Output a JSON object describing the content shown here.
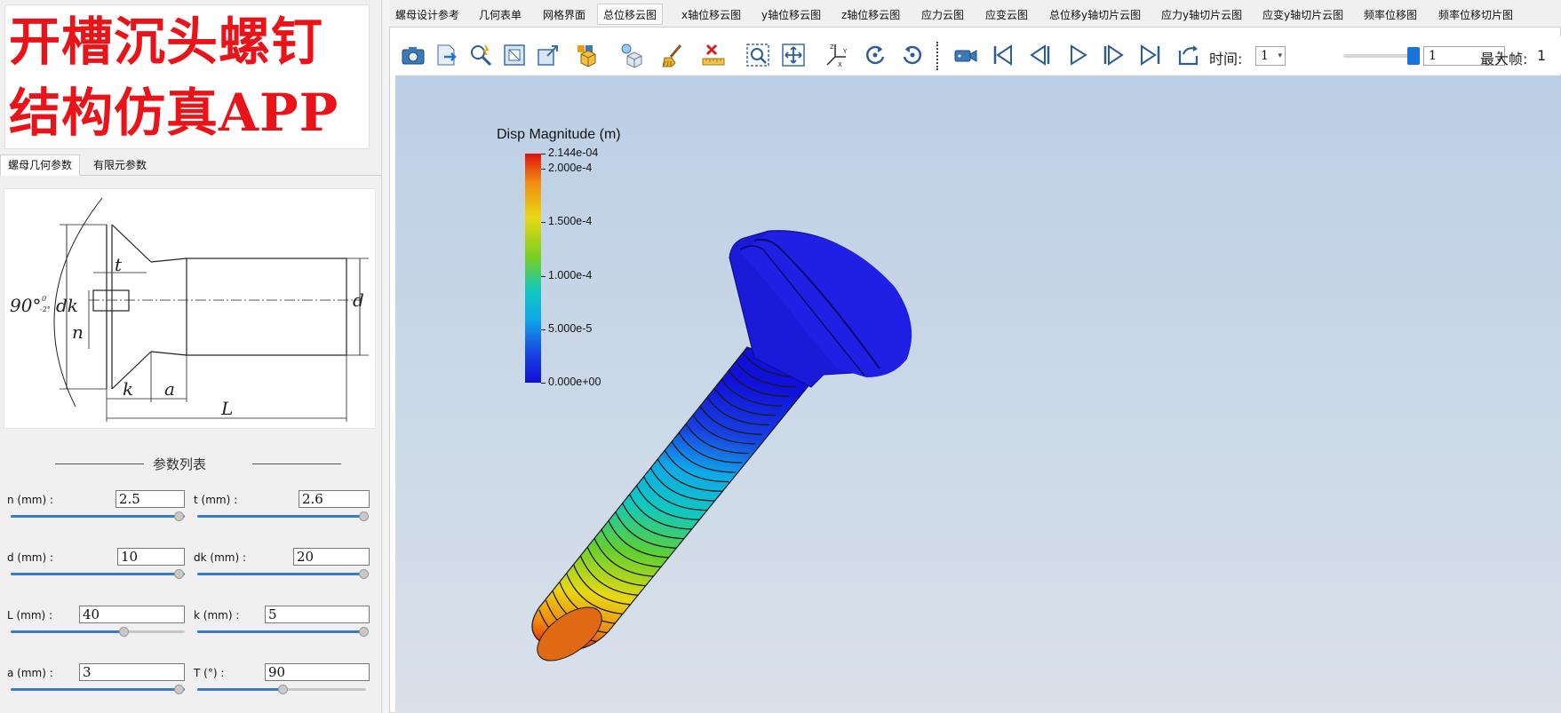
{
  "banner": {
    "line1": "开槽沉头螺钉",
    "line2": "结构仿真APP",
    "color": "#e8141a"
  },
  "left_tabs": [
    {
      "label": "螺母几何参数",
      "active": true
    },
    {
      "label": "有限元参数",
      "active": false
    }
  ],
  "diagram": {
    "angle_label": "90°",
    "angle_tol_upper": "0",
    "angle_tol_lower": "-2°",
    "dim_dk": "dk",
    "dim_t": "t",
    "dim_n": "n",
    "dim_d": "d",
    "dim_k": "k",
    "dim_a": "a",
    "dim_L": "L"
  },
  "params": {
    "title": "参数列表",
    "items": [
      {
        "label": "n (mm) :",
        "value": "2.5",
        "level": 1.0
      },
      {
        "label": "t (mm) :",
        "value": "2.6",
        "level": 1.0
      },
      {
        "label": "d (mm) :",
        "value": "10",
        "level": 1.0
      },
      {
        "label": "dk (mm) :",
        "value": "20",
        "level": 1.0
      },
      {
        "label": "L (mm) :",
        "value": "40",
        "level": 0.65
      },
      {
        "label": "k (mm) :",
        "value": "5",
        "level": 1.0
      },
      {
        "label": "a (mm) :",
        "value": "3",
        "level": 1.0
      },
      {
        "label": "T (°) :",
        "value": "90",
        "level": 0.5
      }
    ]
  },
  "top_tabs": [
    {
      "label": "螺母设计参考",
      "active": false
    },
    {
      "label": "几何表单",
      "active": false
    },
    {
      "label": "网格界面",
      "active": false
    },
    {
      "label": "总位移云图",
      "active": true
    },
    {
      "label": "x轴位移云图",
      "active": false
    },
    {
      "label": "y轴位移云图",
      "active": false
    },
    {
      "label": "z轴位移云图",
      "active": false
    },
    {
      "label": "应力云图",
      "active": false
    },
    {
      "label": "应变云图",
      "active": false
    },
    {
      "label": "总位移y轴切片云图",
      "active": false
    },
    {
      "label": "应力y轴切片云图",
      "active": false
    },
    {
      "label": "应变y轴切片云图",
      "active": false
    },
    {
      "label": "频率位移图",
      "active": false
    },
    {
      "label": "频率位移切片图",
      "active": false
    }
  ],
  "toolbar": {
    "icons": [
      "camera-icon",
      "export-icon",
      "probe-icon",
      "reset-view-icon",
      "fit-view-icon",
      "cube-color-icon",
      "light-icon",
      "clear-brush-icon",
      "delete-ruler-icon",
      "zoom-box-icon",
      "pan-icon",
      "axes-icon",
      "rotate-cw-icon",
      "rotate-ccw-icon",
      "record-video-icon",
      "first-frame-icon",
      "prev-frame-icon",
      "play-icon",
      "next-frame-icon",
      "last-frame-icon",
      "loop-icon"
    ],
    "time_label": "时间:",
    "time_value": "1",
    "frame_value": "1",
    "frame_level": 1.0,
    "max_frame_label": "最大帧:",
    "max_frame_value": "1"
  },
  "viewer": {
    "legend_title": "Disp Magnitude (m)",
    "legend_labels": [
      "2.144e-04",
      "2.000e-4",
      "1.500e-4",
      "1.000e-4",
      "5.000e-5",
      "0.000e+00"
    ],
    "legend_values": [
      0.0002144,
      0.0002,
      0.00015,
      0.0001,
      5e-05,
      0.0
    ],
    "colormap": [
      "#e01010",
      "#f08a10",
      "#e8d814",
      "#78d020",
      "#10c8c0",
      "#10a8e8",
      "#1840e0",
      "#1010d8"
    ],
    "background_top": "#bccfe4",
    "background_bottom": "#d9e1ea"
  }
}
